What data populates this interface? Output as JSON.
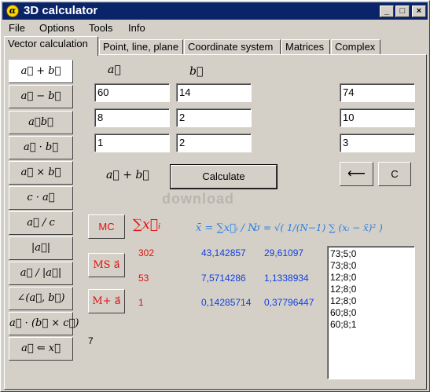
{
  "window": {
    "title": "3D calculator",
    "app_icon": "α"
  },
  "menu": [
    "File",
    "Options",
    "Tools",
    "Info"
  ],
  "tabs": [
    "Vector calculation",
    "Point, line, plane",
    "Coordinate system",
    "Matrices",
    "Complex"
  ],
  "active_tab": 0,
  "operations": [
    "a⃗ + b⃗",
    "a⃗ − b⃗",
    "a⃗b⃗",
    "a⃗ · b⃗",
    "a⃗ × b⃗",
    "c · a⃗",
    "a⃗ / c",
    "|a⃗|",
    "a⃗ / |a⃗|",
    "∠(a⃗, b⃗)",
    "a⃗ · (b⃗ × c⃗)",
    "a⃗ ⇐ x⃗"
  ],
  "selected_operation": 0,
  "inputs": {
    "a_label": "a⃗",
    "b_label": "b⃗",
    "a": [
      "60",
      "8",
      "1"
    ],
    "b": [
      "14",
      "2",
      "2"
    ],
    "result": [
      "74",
      "10",
      "3"
    ]
  },
  "operation_label": "a⃗ + b⃗",
  "buttons": {
    "calculate": "Calculate",
    "back": "⟵",
    "clear": "C",
    "mc": "MC",
    "ms": "MS a⃗",
    "mplus": "M+ a⃗"
  },
  "stats": {
    "sum_symbol": "∑x⃗ᵢ",
    "mean_formula": "x̄ = ∑x⃗ᵢ / N",
    "sigma_formula": "σ = √( 1/(N−1) ∑ (xᵢ − x̄)² )",
    "rows": [
      {
        "sum": "302",
        "mean": "43,142857",
        "sigma": "29,61097"
      },
      {
        "sum": "53",
        "mean": "7,5714286",
        "sigma": "1,1338934"
      },
      {
        "sum": "1",
        "mean": "0,14285714",
        "sigma": "0,37796447"
      }
    ],
    "count": "7"
  },
  "memory_list": [
    "73;5;0",
    "73;8;0",
    "12;8;0",
    "12;8;0",
    "12;8;0",
    "60;8;0",
    "60;8;1"
  ],
  "watermark": "download",
  "colors": {
    "title_bar": "#0a246a",
    "red": "#e01010",
    "blue": "#1040e0",
    "light_blue": "#2a7fe0",
    "face": "#d4d0c8"
  }
}
